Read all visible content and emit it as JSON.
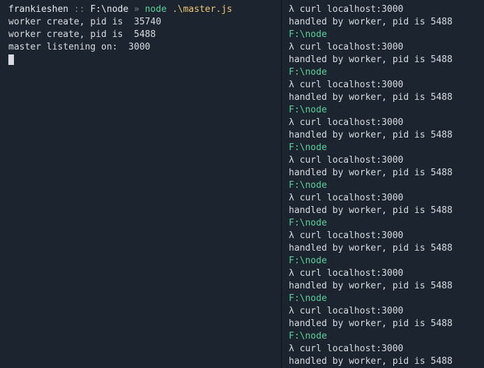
{
  "left": {
    "prompt": {
      "user": "frankieshen",
      "sep1": " :: ",
      "path": "F:\\node",
      "sep2": " » ",
      "exec": "node",
      "arg": " .\\master.js"
    },
    "out1": "worker create, pid is  35740",
    "out2": "worker create, pid is  5488",
    "out3": "master listening on:  3000"
  },
  "right": {
    "lambda_cmd": "λ curl localhost:3000",
    "response": "handled by worker, pid is 5488",
    "path": "F:\\node"
  }
}
